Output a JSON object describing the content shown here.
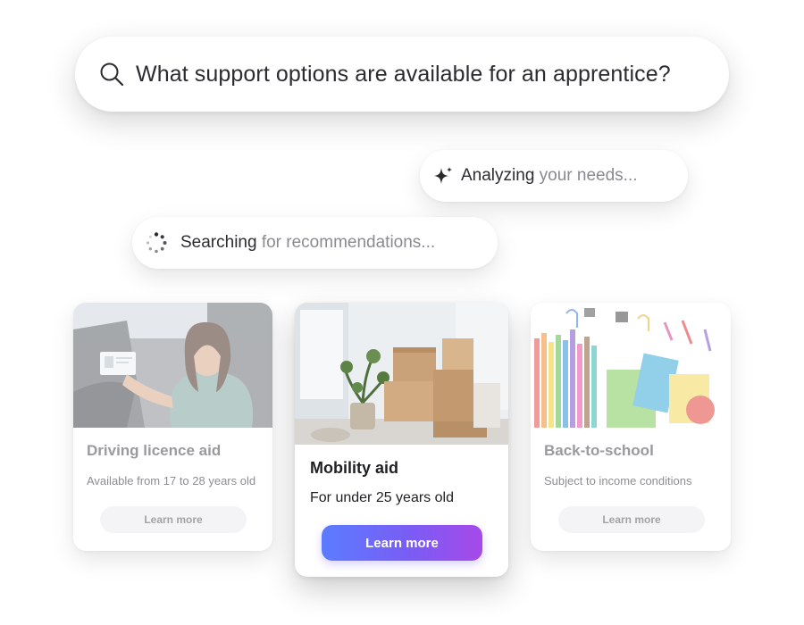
{
  "search": {
    "icon": "search-icon",
    "query": "What support options are available for an apprentice?"
  },
  "status": {
    "analyze": {
      "icon": "sparkle-icon",
      "strong": "Analyzing",
      "fade": " your needs..."
    },
    "search": {
      "icon": "spinner-icon",
      "strong": "Searching",
      "fade": " for recommendations..."
    }
  },
  "cards": [
    {
      "title": "Driving licence aid",
      "subtitle": "Available from 17 to 28 years old",
      "button": "Learn more",
      "state": "faded"
    },
    {
      "title": "Mobility aid",
      "subtitle": "For under 25 years old",
      "button": "Learn more",
      "state": "active"
    },
    {
      "title": "Back-to-school",
      "subtitle": "Subject to income conditions",
      "button": "Learn more",
      "state": "faded"
    }
  ],
  "colors": {
    "button_gradient_start": "#5b7cff",
    "button_gradient_end": "#a649e8"
  }
}
